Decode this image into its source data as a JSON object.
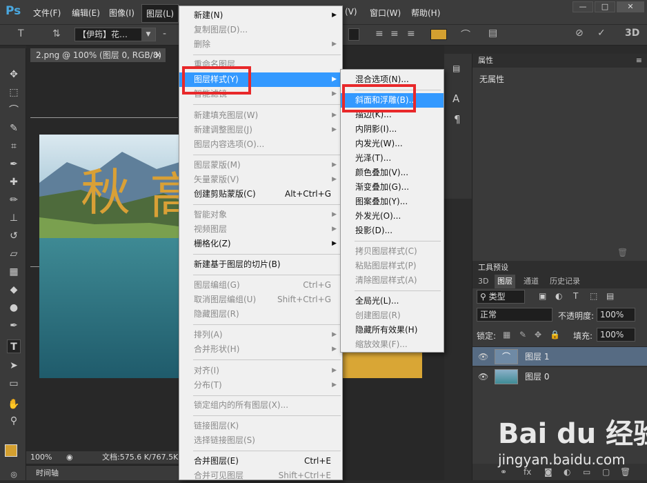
{
  "menubar": {
    "logo": "Ps",
    "items": [
      "文件(F)",
      "编辑(E)",
      "图像(I)",
      "图层(L)",
      "(V)",
      "窗口(W)",
      "帮助(H)"
    ]
  },
  "optbar": {
    "font": "【伊筠】花…"
  },
  "document": {
    "tab": "2.png @ 100% (图层 0, RGB/8)",
    "zoom": "100%",
    "file_size": "文档:575.6 K/767.5K",
    "timeline": "时间轴"
  },
  "properties": {
    "title": "属性",
    "content": "无属性"
  },
  "tool_presets": {
    "title": "工具预设"
  },
  "layers_panel": {
    "tabs": [
      "3D",
      "图层",
      "通道",
      "历史记录"
    ],
    "filter": "类型",
    "blend_mode": "正常",
    "opacity_label": "不透明度:",
    "opacity_value": "100%",
    "lock_label": "锁定:",
    "fill_label": "填充:",
    "fill_value": "100%",
    "layers": [
      {
        "name": "图层 1",
        "selected": true
      },
      {
        "name": "图层 0",
        "selected": false
      }
    ]
  },
  "layer_menu": {
    "items": [
      {
        "label": "新建(N)",
        "disabled": false,
        "submenu": true,
        "shortcut": ""
      },
      {
        "label": "复制图层(D)...",
        "disabled": true,
        "submenu": false,
        "shortcut": ""
      },
      {
        "label": "删除",
        "disabled": true,
        "submenu": true,
        "shortcut": ""
      },
      {
        "label": "重命名图层",
        "disabled": true,
        "submenu": false,
        "shortcut": ""
      },
      {
        "label": "图层样式(Y)",
        "disabled": false,
        "submenu": true,
        "shortcut": "",
        "highlighted": true
      },
      {
        "label": "智能滤镜",
        "disabled": true,
        "submenu": true,
        "shortcut": ""
      },
      {
        "label": "新建填充图层(W)",
        "disabled": true,
        "submenu": true,
        "shortcut": ""
      },
      {
        "label": "新建调整图层(J)",
        "disabled": true,
        "submenu": true,
        "shortcut": ""
      },
      {
        "label": "图层内容选项(O)...",
        "disabled": true,
        "submenu": false,
        "shortcut": ""
      },
      {
        "label": "图层蒙版(M)",
        "disabled": true,
        "submenu": true,
        "shortcut": ""
      },
      {
        "label": "矢量蒙版(V)",
        "disabled": true,
        "submenu": true,
        "shortcut": ""
      },
      {
        "label": "创建剪贴蒙版(C)",
        "disabled": false,
        "submenu": false,
        "shortcut": "Alt+Ctrl+G"
      },
      {
        "label": "智能对象",
        "disabled": true,
        "submenu": true,
        "shortcut": ""
      },
      {
        "label": "视频图层",
        "disabled": true,
        "submenu": true,
        "shortcut": ""
      },
      {
        "label": "栅格化(Z)",
        "disabled": false,
        "submenu": true,
        "shortcut": ""
      },
      {
        "label": "新建基于图层的切片(B)",
        "disabled": false,
        "submenu": false,
        "shortcut": ""
      },
      {
        "label": "图层编组(G)",
        "disabled": true,
        "submenu": false,
        "shortcut": "Ctrl+G"
      },
      {
        "label": "取消图层编组(U)",
        "disabled": true,
        "submenu": false,
        "shortcut": "Shift+Ctrl+G"
      },
      {
        "label": "隐藏图层(R)",
        "disabled": true,
        "submenu": false,
        "shortcut": ""
      },
      {
        "label": "排列(A)",
        "disabled": true,
        "submenu": true,
        "shortcut": ""
      },
      {
        "label": "合并形状(H)",
        "disabled": true,
        "submenu": true,
        "shortcut": ""
      },
      {
        "label": "对齐(I)",
        "disabled": true,
        "submenu": true,
        "shortcut": ""
      },
      {
        "label": "分布(T)",
        "disabled": true,
        "submenu": true,
        "shortcut": ""
      },
      {
        "label": "锁定组内的所有图层(X)...",
        "disabled": true,
        "submenu": false,
        "shortcut": ""
      },
      {
        "label": "链接图层(K)",
        "disabled": true,
        "submenu": false,
        "shortcut": ""
      },
      {
        "label": "选择链接图层(S)",
        "disabled": true,
        "submenu": false,
        "shortcut": ""
      },
      {
        "label": "合并图层(E)",
        "disabled": false,
        "submenu": false,
        "shortcut": "Ctrl+E"
      },
      {
        "label": "合并可见图层",
        "disabled": true,
        "submenu": false,
        "shortcut": "Shift+Ctrl+E"
      }
    ]
  },
  "style_submenu": {
    "items": [
      {
        "label": "混合选项(N)...",
        "disabled": false
      },
      {
        "label": "斜面和浮雕(B)...",
        "disabled": false,
        "highlighted": true
      },
      {
        "label": "描边(K)...",
        "disabled": false
      },
      {
        "label": "内阴影(I)...",
        "disabled": false
      },
      {
        "label": "内发光(W)...",
        "disabled": false
      },
      {
        "label": "光泽(T)...",
        "disabled": false
      },
      {
        "label": "颜色叠加(V)...",
        "disabled": false
      },
      {
        "label": "渐变叠加(G)...",
        "disabled": false
      },
      {
        "label": "图案叠加(Y)...",
        "disabled": false
      },
      {
        "label": "外发光(O)...",
        "disabled": false
      },
      {
        "label": "投影(D)...",
        "disabled": false
      },
      {
        "label": "拷贝图层样式(C)",
        "disabled": true
      },
      {
        "label": "粘贴图层样式(P)",
        "disabled": true
      },
      {
        "label": "清除图层样式(A)",
        "disabled": true
      },
      {
        "label": "全局光(L)...",
        "disabled": false
      },
      {
        "label": "创建图层(R)",
        "disabled": true
      },
      {
        "label": "隐藏所有效果(H)",
        "disabled": false
      },
      {
        "label": "缩放效果(F)...",
        "disabled": true
      }
    ]
  },
  "canvas_text": "秋",
  "canvas_text_partial": "高",
  "watermark": {
    "brand": "Bai du 经验",
    "url": "jingyan.baidu.com"
  },
  "colors": {
    "highlight": "#3399ff",
    "annotation": "#e8282a",
    "accent_swatch": "#d4a030"
  }
}
